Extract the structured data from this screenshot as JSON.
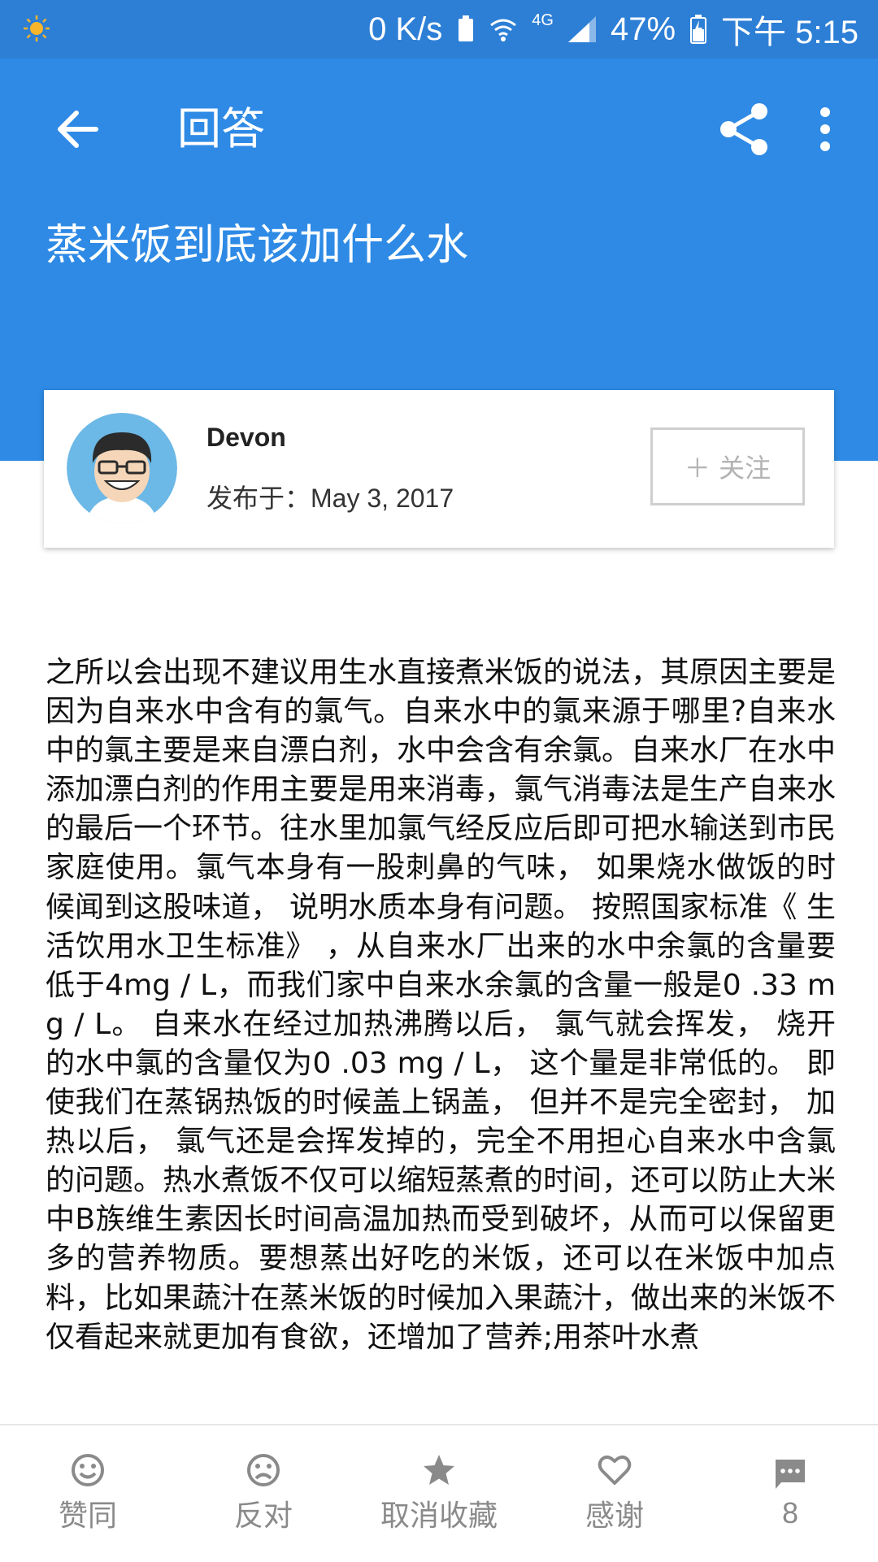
{
  "status_bar": {
    "speed": "0 K/s",
    "network": "4G",
    "battery": "47%",
    "time": "下午 5:15"
  },
  "header": {
    "title": "回答",
    "question": "蒸米饭到底该加什么水"
  },
  "author": {
    "name": "Devon",
    "date_prefix": "发布于：",
    "date": "May 3, 2017",
    "follow_label": "＋ 关注"
  },
  "answer": {
    "text": "之所以会出现不建议用生水直接煮米饭的说法，其原因主要是因为自来水中含有的氯气。自来水中的氯来源于哪里?自来水中的氯主要是来自漂白剂，水中会含有余氯。自来水厂在水中添加漂白剂的作用主要是用来消毒，氯气消毒法是生产自来水的最后一个环节。往水里加氯气经反应后即可把水输送到市民家庭使用。氯气本身有一股刺鼻的气味， 如果烧水做饭的时候闻到这股味道， 说明水质本身有问题。 按照国家标准《 生活饮用水卫生标准》 ，从自来水厂出来的水中余氯的含量要低于4mg / L，而我们家中自来水余氯的含量一般是0 .33 mg / L。 自来水在经过加热沸腾以后， 氯气就会挥发， 烧开的水中氯的含量仅为0 .03 mg / L， 这个量是非常低的。 即使我们在蒸锅热饭的时候盖上锅盖， 但并不是完全密封， 加热以后， 氯气还是会挥发掉的，完全不用担心自来水中含氯的问题。热水煮饭不仅可以缩短蒸煮的时间，还可以防止大米中B族维生素因长时间高温加热而受到破坏，从而可以保留更多的营养物质。要想蒸出好吃的米饭，还可以在米饭中加点料，比如果蔬汁在蒸米饭的时候加入果蔬汁，做出来的米饭不仅看起来就更加有食欲，还增加了营养;用茶叶水煮"
  },
  "bottom_bar": {
    "agree": "赞同",
    "oppose": "反对",
    "unfavorite": "取消收藏",
    "thanks": "感谢",
    "comments": "8"
  },
  "colors": {
    "primary": "#2e8ae5",
    "status_bar": "#2d7fd6",
    "icon_gray": "#8a8a8a"
  }
}
